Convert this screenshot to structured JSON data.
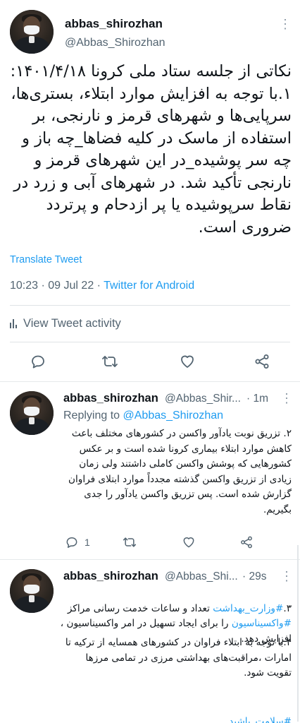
{
  "main_tweet": {
    "author_name": "abbas_shirozhan",
    "author_handle": "@Abbas_Shirozhan",
    "more_icon": "more-dots-icon",
    "text": "نکاتی از جلسه ستاد ملی کرونا ۱۴۰۱/۴/۱۸:\n۱.با توجه به افزایش موارد ابتلاء، بستری‌ها، سرپایی‌ها و شهرهای قرمز و نارنجی، بر استفاده از ماسک در کلیه فضاها_چه باز و چه سر پوشیده_در این شهرهای قرمز و نارنجی تأکید شد. در شهرهای آبی و زرد در نقاط سرپوشیده یا پر ازدحام و پرتردد ضروری است.",
    "translate_label": "Translate Tweet",
    "time": "10:23",
    "date": "09 Jul 22",
    "source": "Twitter for Android",
    "activity_label": "View Tweet activity"
  },
  "reply_1": {
    "author_name": "abbas_shirozhan",
    "author_handle": "@Abbas_Shir...",
    "age": "1m",
    "replying_prefix": "Replying to",
    "replying_to": "@Abbas_Shirozhan",
    "text": "۲. تزریق نوبت یادآور واکسن در کشورهای مختلف باعث کاهش موارد ابتلاء بیماری کرونا شده است و بر عکس کشورهایی که پوشش واکسن کاملی داشتند ولی زمان زیادی از تزریق واکسن گذشته مجدداً موارد ابتلای فراوان گزارش شده است. پس تزریق واکسن یادآور را جدی بگیریم.",
    "reply_count": "1"
  },
  "reply_2": {
    "author_name": "abbas_shirozhan",
    "author_handle": "@Abbas_Shi...",
    "age": "29s",
    "line_1_prefix": "۳.",
    "hashtag_1": "#وزارت_بهداشت",
    "line_1_mid": " تعداد و ساعات خدمت رسانی مراکز ",
    "hashtag_2": "#واکسیناسیون",
    "line_1_rest": " را برای ایجاد تسهیل در امر واکسیناسیون ، افزایش دهد.",
    "line_2": "۴.با توجه به ابتلاء فراوان در کشورهای همسایه از ترکیه تا امارات ،مراقبت‌های بهداشتی مرزی در تمامی مرزها تقویت شود.",
    "hashtag_3": "#سلامت_باشید"
  },
  "icons": {
    "reply": "reply-icon",
    "retweet": "retweet-icon",
    "like": "heart-icon",
    "share": "share-icon",
    "activity": "bar-chart-icon"
  }
}
